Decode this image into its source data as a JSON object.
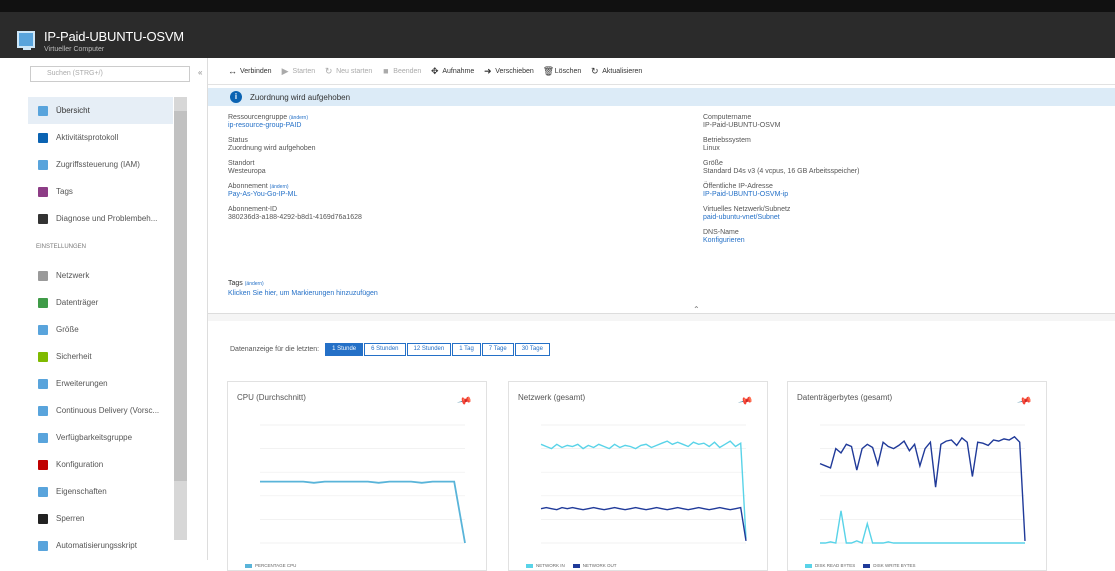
{
  "window": {
    "title": "IP-Paid-UBUNTU-OSVM",
    "subtitle": "Virtueller Computer"
  },
  "sidebar": {
    "search_placeholder": "Suchen (STRG+/)",
    "collapse_label": "«",
    "items": [
      {
        "label": "Übersicht",
        "icon": "monitor-icon",
        "color": "#59a4dc",
        "active": true
      },
      {
        "label": "Aktivitätsprotokoll",
        "icon": "log-icon",
        "color": "#0b63b2"
      },
      {
        "label": "Zugriffssteuerung (IAM)",
        "icon": "users-icon",
        "color": "#59a4dc"
      },
      {
        "label": "Tags",
        "icon": "tag-icon",
        "color": "#8d3d86"
      }
    ],
    "partial_items": [
      {
        "label": "Diagnose und Problembeh...",
        "icon": "wrench-icon",
        "color": "#333"
      }
    ],
    "section_heading": "EINSTELLUNGEN",
    "settings_items": [
      {
        "label": "Netzwerk",
        "icon": "network-icon",
        "color": "#9a9a9a"
      },
      {
        "label": "Datenträger",
        "icon": "disk-icon",
        "color": "#3f9b48"
      },
      {
        "label": "Größe",
        "icon": "size-icon",
        "color": "#59a4dc"
      },
      {
        "label": "Sicherheit",
        "icon": "shield-icon",
        "color": "#7fba00"
      },
      {
        "label": "Erweiterungen",
        "icon": "extension-icon",
        "color": "#59a4dc"
      },
      {
        "label": "Continuous Delivery (Vorsc...",
        "icon": "delivery-icon",
        "color": "#59a4dc"
      },
      {
        "label": "Verfügbarkeitsgruppe",
        "icon": "availability-icon",
        "color": "#59a4dc"
      },
      {
        "label": "Konfiguration",
        "icon": "config-icon",
        "color": "#c00000"
      },
      {
        "label": "Eigenschaften",
        "icon": "properties-icon",
        "color": "#59a4dc"
      },
      {
        "label": "Sperren",
        "icon": "lock-icon",
        "color": "#222"
      },
      {
        "label": "Automatisierungsskript",
        "icon": "script-icon",
        "color": "#59a4dc"
      }
    ]
  },
  "toolbar": {
    "items": [
      {
        "label": "Verbinden",
        "icon": "↔",
        "disabled": false
      },
      {
        "label": "Starten",
        "icon": "▶",
        "disabled": true
      },
      {
        "label": "Neu starten",
        "icon": "↻",
        "disabled": true
      },
      {
        "label": "Beenden",
        "icon": "■",
        "disabled": true
      },
      {
        "label": "Aufnahme",
        "icon": "✥",
        "disabled": false
      },
      {
        "label": "Verschieben",
        "icon": "➜",
        "disabled": false
      },
      {
        "label": "Löschen",
        "icon": "🗑",
        "disabled": false
      },
      {
        "label": "Aktualisieren",
        "icon": "↻",
        "disabled": false
      }
    ]
  },
  "banner": {
    "text": "Zuordnung wird aufgehoben"
  },
  "essentials": {
    "left": [
      {
        "label": "Ressourcengruppe",
        "change": "(ändern)",
        "value": "ip-resource-group-PAID",
        "link": true
      },
      {
        "label": "Status",
        "value": "Zuordnung wird aufgehoben",
        "link": false
      },
      {
        "label": "Standort",
        "value": "Westeuropa",
        "link": false
      },
      {
        "label": "Abonnement",
        "change": "(ändern)",
        "value": "Pay-As-You-Go-IP-ML",
        "link": true
      },
      {
        "label": "Abonnement-ID",
        "value": "380236d3-a188-4292-b8d1-4169d76a1628",
        "link": false
      }
    ],
    "right": [
      {
        "label": "Computername",
        "value": "IP-Paid-UBUNTU-OSVM",
        "link": false
      },
      {
        "label": "Betriebssystem",
        "value": "Linux",
        "link": false
      },
      {
        "label": "Größe",
        "value": "Standard D4s v3 (4 vcpus, 16 GB Arbeitsspeicher)",
        "link": false
      },
      {
        "label": "Öffentliche IP-Adresse",
        "value": "IP-Paid-UBUNTU-OSVM-ip",
        "link": true
      },
      {
        "label": "Virtuelles Netzwerk/Subnetz",
        "value": "paid-ubuntu-vnet/Subnet",
        "link": true
      },
      {
        "label": "DNS-Name",
        "value": "Konfigurieren",
        "link": true
      }
    ],
    "tags_label": "Tags",
    "tags_change": "(ändern)",
    "tags_link": "Klicken Sie hier, um Markierungen hinzuzufügen",
    "collapse": "⌃"
  },
  "monitoring": {
    "range_label": "Datenanzeige für die letzten:",
    "ranges": [
      "1 Stunde",
      "6 Stunden",
      "12 Stunden",
      "1 Tag",
      "7 Tage",
      "30 Tage"
    ],
    "active_range": 0
  },
  "charts": [
    {
      "title": "CPU (Durchschnitt)",
      "legend": [
        {
          "name": "PERCENTAGE CPU",
          "color": "#59b4d9"
        }
      ]
    },
    {
      "title": "Netzwerk (gesamt)",
      "legend": [
        {
          "name": "NETWORK IN",
          "color": "#59d3e8"
        },
        {
          "name": "NETWORK OUT",
          "color": "#203a99"
        }
      ]
    },
    {
      "title": "Datenträgerbytes (gesamt)",
      "legend": [
        {
          "name": "DISK READ BYTES",
          "color": "#59d3e8"
        },
        {
          "name": "DISK WRITE BYTES",
          "color": "#203a99"
        }
      ]
    }
  ],
  "chart_data": [
    {
      "type": "line",
      "title": "CPU (Durchschnitt)",
      "series": [
        {
          "name": "PERCENTAGE CPU",
          "values": [
            52,
            52,
            52,
            52,
            52,
            51,
            52,
            52,
            52,
            52,
            52,
            51,
            52,
            52,
            52,
            51,
            52,
            52,
            52,
            0
          ]
        }
      ],
      "ylim": [
        0,
        100
      ]
    },
    {
      "type": "line",
      "title": "Netzwerk (gesamt)",
      "series": [
        {
          "name": "NETWORK IN",
          "values": [
            92,
            90,
            88,
            92,
            89,
            91,
            90,
            92,
            88,
            91,
            89,
            92,
            90,
            88,
            92,
            89,
            91,
            90,
            88,
            91,
            92,
            89,
            91,
            93,
            95,
            92,
            94,
            92,
            90,
            94,
            92,
            93,
            90,
            94,
            89,
            92,
            95,
            90,
            93,
            4
          ]
        },
        {
          "name": "NETWORK OUT",
          "values": [
            32,
            33,
            32,
            31,
            33,
            32,
            33,
            32,
            31,
            32,
            33,
            32,
            31,
            32,
            33,
            32,
            31,
            32,
            33,
            32,
            31,
            32,
            33,
            32,
            31,
            32,
            33,
            32,
            31,
            32,
            33,
            32,
            31,
            32,
            33,
            32,
            31,
            32,
            33,
            2
          ]
        }
      ],
      "ylim": [
        0,
        110
      ]
    },
    {
      "type": "line",
      "title": "Datenträgerbytes (gesamt)",
      "series": [
        {
          "name": "DISK READ BYTES",
          "values": [
            0,
            0,
            1,
            0,
            30,
            0,
            0,
            2,
            0,
            18,
            0,
            0,
            0,
            1,
            0,
            0,
            0,
            0,
            0,
            0,
            0,
            0,
            0,
            0,
            0,
            0,
            0,
            0,
            0,
            0,
            0,
            0,
            0,
            0,
            0,
            0,
            0,
            0,
            0,
            0
          ]
        },
        {
          "name": "DISK WRITE BYTES",
          "values": [
            74,
            72,
            70,
            88,
            84,
            92,
            90,
            68,
            88,
            92,
            89,
            73,
            94,
            90,
            88,
            91,
            95,
            86,
            92,
            72,
            88,
            94,
            52,
            92,
            95,
            96,
            91,
            98,
            94,
            62,
            94,
            93,
            91,
            96,
            95,
            97,
            96,
            99,
            94,
            2
          ]
        }
      ],
      "ylim": [
        0,
        110
      ]
    }
  ]
}
